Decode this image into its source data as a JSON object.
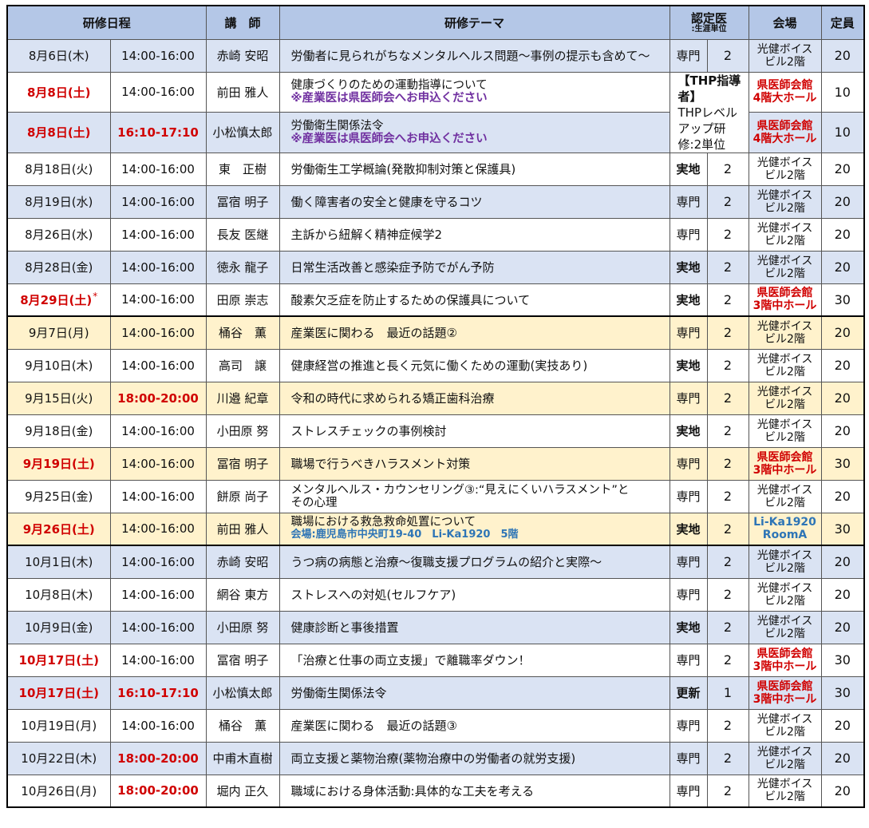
{
  "headers": {
    "date": "研修日程",
    "lecturer": "講　師",
    "theme": "研修テーマ",
    "credit_main": "認定医",
    "credit_sub": ":生涯単位",
    "venue": "会場",
    "capacity": "定員"
  },
  "thp_box": {
    "title": "【THP指導者】",
    "body": "THPレベルアップ研修:2単位"
  },
  "rows": [
    {
      "date": "8月6日(木)",
      "time": "14:00-16:00",
      "lecturer": "赤崎 安昭",
      "theme": "労働者に見られがちなメンタルヘルス問題～事例の提示も含めて～",
      "category": "専門",
      "units": "2",
      "venue1": "光健ボイス",
      "venue2": "ビル2階",
      "capacity": "20"
    },
    {
      "date": "8月8日(土)",
      "time": "14:00-16:00",
      "lecturer": "前田 雅人",
      "theme": "健康づくりのための運動指導について",
      "note": "※産業医は県医師会へお申込ください",
      "venue1": "県医師会館",
      "venue2": "4階大ホール",
      "capacity": "10"
    },
    {
      "date": "8月8日(土)",
      "time": "16:10-17:10",
      "lecturer": "小松慎太郎",
      "theme": "労働衛生関係法令",
      "note": "※産業医は県医師会へお申込ください",
      "venue1": "県医師会館",
      "venue2": "4階大ホール",
      "capacity": "10"
    },
    {
      "date": "8月18日(火)",
      "time": "14:00-16:00",
      "lecturer": "東　正樹",
      "theme": "労働衛生工学概論(発散抑制対策と保護具)",
      "category": "実地",
      "units": "2",
      "venue1": "光健ボイス",
      "venue2": "ビル2階",
      "capacity": "20"
    },
    {
      "date": "8月19日(水)",
      "time": "14:00-16:00",
      "lecturer": "冨宿 明子",
      "theme": "働く障害者の安全と健康を守るコツ",
      "category": "専門",
      "units": "2",
      "venue1": "光健ボイス",
      "venue2": "ビル2階",
      "capacity": "20"
    },
    {
      "date": "8月26日(水)",
      "time": "14:00-16:00",
      "lecturer": "長友 医継",
      "theme": "主訴から紐解く精神症候学2",
      "category": "専門",
      "units": "2",
      "venue1": "光健ボイス",
      "venue2": "ビル2階",
      "capacity": "20"
    },
    {
      "date": "8月28日(金)",
      "time": "14:00-16:00",
      "lecturer": "徳永 龍子",
      "theme": "日常生活改善と感染症予防でがん予防",
      "category": "実地",
      "units": "2",
      "venue1": "光健ボイス",
      "venue2": "ビル2階",
      "capacity": "20"
    },
    {
      "date": "8月29日(土)",
      "star": "*",
      "time": "14:00-16:00",
      "lecturer": "田原 崇志",
      "theme": "酸素欠乏症を防止するための保護具について",
      "category": "実地",
      "units": "2",
      "venue1": "県医師会館",
      "venue2": "3階中ホール",
      "capacity": "30"
    },
    {
      "date": "9月7日(月)",
      "time": "14:00-16:00",
      "lecturer": "桶谷　薫",
      "theme": "産業医に関わる　最近の話題②",
      "category": "専門",
      "units": "2",
      "venue1": "光健ボイス",
      "venue2": "ビル2階",
      "capacity": "20"
    },
    {
      "date": "9月10日(木)",
      "time": "14:00-16:00",
      "lecturer": "高司　譲",
      "theme": "健康経営の推進と長く元気に働くための運動(実技あり)",
      "category": "実地",
      "units": "2",
      "venue1": "光健ボイス",
      "venue2": "ビル2階",
      "capacity": "20"
    },
    {
      "date": "9月15日(火)",
      "time": "18:00-20:00",
      "lecturer": "川邉 紀章",
      "theme": "令和の時代に求められる矯正歯科治療",
      "category": "専門",
      "units": "2",
      "venue1": "光健ボイス",
      "venue2": "ビル2階",
      "capacity": "20"
    },
    {
      "date": "9月18日(金)",
      "time": "14:00-16:00",
      "lecturer": "小田原 努",
      "theme": "ストレスチェックの事例検討",
      "category": "実地",
      "units": "2",
      "venue1": "光健ボイス",
      "venue2": "ビル2階",
      "capacity": "20"
    },
    {
      "date": "9月19日(土)",
      "time": "14:00-16:00",
      "lecturer": "冨宿 明子",
      "theme": "職場で行うべきハラスメント対策",
      "category": "専門",
      "units": "2",
      "venue1": "県医師会館",
      "venue2": "3階中ホール",
      "capacity": "30"
    },
    {
      "date": "9月25日(金)",
      "time": "14:00-16:00",
      "lecturer": "餅原 尚子",
      "theme": "メンタルヘルス・カウンセリング③:“見えにくいハラスメント”と",
      "theme2": "その心理",
      "category": "専門",
      "units": "2",
      "venue1": "光健ボイス",
      "venue2": "ビル2階",
      "capacity": "20"
    },
    {
      "date": "9月26日(土)",
      "time": "14:00-16:00",
      "lecturer": "前田 雅人",
      "theme": "職場における救急救命処置について",
      "note": "会場:鹿児島市中央町19-40　Li-Ka1920　5階",
      "category": "実地",
      "units": "2",
      "venue1": "Li-Ka1920",
      "venue2": "RoomA",
      "capacity": "30"
    },
    {
      "date": "10月1日(木)",
      "time": "14:00-16:00",
      "lecturer": "赤崎 安昭",
      "theme": "うつ病の病態と治療～復職支援プログラムの紹介と実際～",
      "category": "専門",
      "units": "2",
      "venue1": "光健ボイス",
      "venue2": "ビル2階",
      "capacity": "20"
    },
    {
      "date": "10月8日(木)",
      "time": "14:00-16:00",
      "lecturer": "網谷 東方",
      "theme": "ストレスへの対処(セルフケア)",
      "category": "専門",
      "units": "2",
      "venue1": "光健ボイス",
      "venue2": "ビル2階",
      "capacity": "20"
    },
    {
      "date": "10月9日(金)",
      "time": "14:00-16:00",
      "lecturer": "小田原 努",
      "theme": "健康診断と事後措置",
      "category": "実地",
      "units": "2",
      "venue1": "光健ボイス",
      "venue2": "ビル2階",
      "capacity": "20"
    },
    {
      "date": "10月17日(土)",
      "time": "14:00-16:00",
      "lecturer": "冨宿 明子",
      "theme": "「治療と仕事の両立支援」で離職率ダウン！",
      "category": "専門",
      "units": "2",
      "venue1": "県医師会館",
      "venue2": "3階中ホール",
      "capacity": "30"
    },
    {
      "date": "10月17日(土)",
      "time": "16:10-17:10",
      "lecturer": "小松慎太郎",
      "theme": "労働衛生関係法令",
      "category": "更新",
      "units": "1",
      "venue1": "県医師会館",
      "venue2": "3階中ホール",
      "capacity": "30"
    },
    {
      "date": "10月19日(月)",
      "time": "14:00-16:00",
      "lecturer": "桶谷　薫",
      "theme": "産業医に関わる　最近の話題③",
      "category": "専門",
      "units": "2",
      "venue1": "光健ボイス",
      "venue2": "ビル2階",
      "capacity": "20"
    },
    {
      "date": "10月22日(木)",
      "time": "18:00-20:00",
      "lecturer": "中甫木直樹",
      "theme": "両立支援と薬物治療(薬物治療中の労働者の就労支援)",
      "category": "専門",
      "units": "2",
      "venue1": "光健ボイス",
      "venue2": "ビル2階",
      "capacity": "20"
    },
    {
      "date": "10月26日(月)",
      "time": "18:00-20:00",
      "lecturer": "堀内 正久",
      "theme": "職域における身体活動:具体的な工夫を考える",
      "category": "専門",
      "units": "2",
      "venue1": "光健ボイス",
      "venue2": "ビル2階",
      "capacity": "20"
    }
  ]
}
